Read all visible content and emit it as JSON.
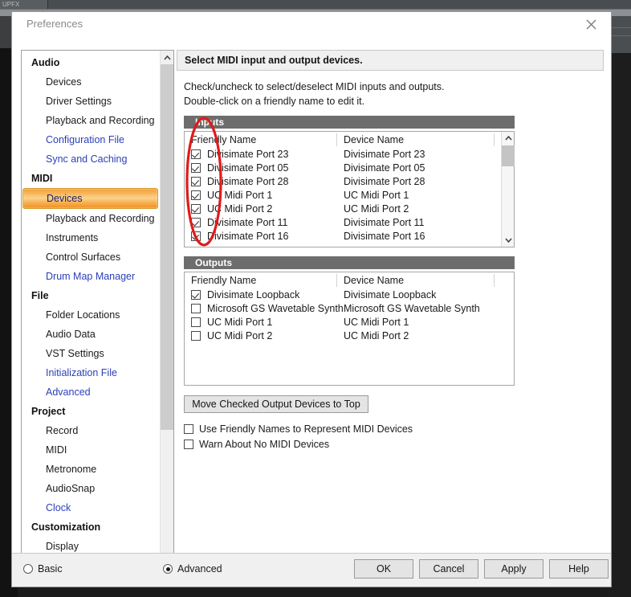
{
  "background": {
    "tab_label": "UPFX"
  },
  "dialog": {
    "title": "Preferences",
    "close_icon": "close-icon"
  },
  "sidebar": {
    "groups": [
      {
        "label": "Audio",
        "items": [
          {
            "label": "Devices",
            "style": "plain"
          },
          {
            "label": "Driver Settings",
            "style": "plain"
          },
          {
            "label": "Playback and Recording",
            "style": "plain"
          },
          {
            "label": "Configuration File",
            "style": "link"
          },
          {
            "label": "Sync and Caching",
            "style": "link"
          }
        ]
      },
      {
        "label": "MIDI",
        "items": [
          {
            "label": "Devices",
            "style": "selected"
          },
          {
            "label": "Playback and Recording",
            "style": "plain"
          },
          {
            "label": "Instruments",
            "style": "plain"
          },
          {
            "label": "Control Surfaces",
            "style": "plain"
          },
          {
            "label": "Drum Map Manager",
            "style": "link"
          }
        ]
      },
      {
        "label": "File",
        "items": [
          {
            "label": "Folder Locations",
            "style": "plain"
          },
          {
            "label": "Audio Data",
            "style": "plain"
          },
          {
            "label": "VST Settings",
            "style": "plain"
          },
          {
            "label": "Initialization File",
            "style": "link"
          },
          {
            "label": "Advanced",
            "style": "link"
          }
        ]
      },
      {
        "label": "Project",
        "items": [
          {
            "label": "Record",
            "style": "plain"
          },
          {
            "label": "MIDI",
            "style": "plain"
          },
          {
            "label": "Metronome",
            "style": "plain"
          },
          {
            "label": "AudioSnap",
            "style": "plain"
          },
          {
            "label": "Clock",
            "style": "link"
          }
        ]
      },
      {
        "label": "Customization",
        "items": [
          {
            "label": "Display",
            "style": "plain"
          }
        ]
      }
    ],
    "scroll_up_icon": "chevron-up-icon",
    "scroll_down_icon": "chevron-down-icon"
  },
  "pane": {
    "header": "Select MIDI input and output devices.",
    "description_line1": "Check/uncheck to select/deselect MIDI inputs and outputs.",
    "description_line2": "Double-click on a friendly name to edit it.",
    "inputs": {
      "section_label": "Inputs",
      "columns": {
        "friendly": "Friendly Name",
        "device": "Device Name"
      },
      "rows": [
        {
          "friendly": "Divisimate Port 23",
          "device": "Divisimate Port 23",
          "checked": true
        },
        {
          "friendly": "Divisimate Port 05",
          "device": "Divisimate Port 05",
          "checked": true
        },
        {
          "friendly": "Divisimate Port 28",
          "device": "Divisimate Port 28",
          "checked": true
        },
        {
          "friendly": "UC Midi Port 1",
          "device": "UC Midi Port 1",
          "checked": true
        },
        {
          "friendly": "UC Midi Port 2",
          "device": "UC Midi Port 2",
          "checked": true
        },
        {
          "friendly": "Divisimate Port 11",
          "device": "Divisimate Port 11",
          "checked": true
        },
        {
          "friendly": "Divisimate Port 16",
          "device": "Divisimate Port 16",
          "checked": true
        }
      ],
      "scroll_up_icon": "chevron-up-icon",
      "scroll_down_icon": "chevron-down-icon"
    },
    "outputs": {
      "section_label": "Outputs",
      "columns": {
        "friendly": "Friendly Name",
        "device": "Device Name"
      },
      "rows": [
        {
          "friendly": "Divisimate Loopback",
          "device": "Divisimate Loopback",
          "checked": true
        },
        {
          "friendly": "Microsoft GS Wavetable Synth",
          "device": "Microsoft GS Wavetable Synth",
          "checked": false
        },
        {
          "friendly": "UC Midi Port 1",
          "device": "UC Midi Port 1",
          "checked": false
        },
        {
          "friendly": "UC Midi Port 2",
          "device": "UC Midi Port 2",
          "checked": false
        }
      ]
    },
    "move_button": "Move Checked Output Devices to Top",
    "options": [
      {
        "label": "Use Friendly Names to Represent MIDI Devices",
        "checked": false
      },
      {
        "label": "Warn About No MIDI Devices",
        "checked": false
      }
    ]
  },
  "footer": {
    "radios": [
      {
        "label": "Basic",
        "selected": false
      },
      {
        "label": "Advanced",
        "selected": true
      }
    ],
    "buttons": [
      {
        "label": "OK"
      },
      {
        "label": "Cancel"
      },
      {
        "label": "Apply"
      },
      {
        "label": "Help"
      }
    ]
  },
  "annotation": {
    "shape": "ellipse",
    "color": "#e01b1b",
    "target": "inputs-checkbox-column"
  },
  "colors": {
    "selected_item_accent": "#f0a040",
    "link_text": "#2b3fb8",
    "section_bar": "#6d6d6d",
    "annotation_red": "#e01b1b"
  }
}
